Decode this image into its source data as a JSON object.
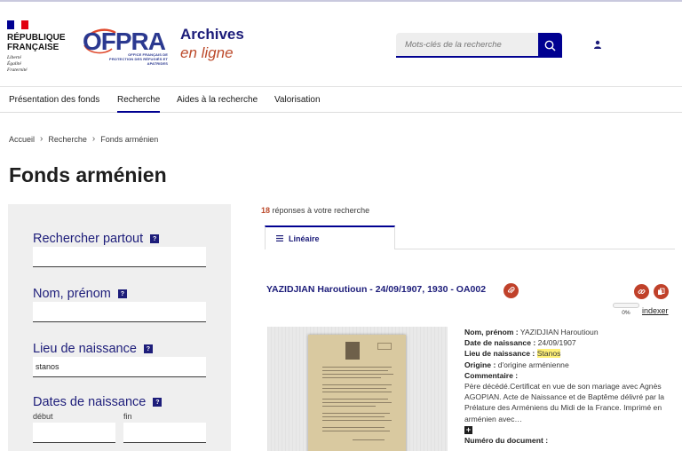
{
  "header": {
    "republique": [
      "RÉPUBLIQUE",
      "FRANÇAISE"
    ],
    "motto": [
      "Liberté",
      "Égalité",
      "Fraternité"
    ],
    "ofpra_name": "OFPRA",
    "ofpra_subtitle": "OFFICE FRANÇAIS DE PROTECTION DES RÉFUGIÉS ET APATRIDES",
    "site_title_line1": "Archives",
    "site_title_line2": "en ligne",
    "search_placeholder": "Mots-clés de la recherche"
  },
  "nav": {
    "items": [
      "Présentation des fonds",
      "Recherche",
      "Aides à la recherche",
      "Valorisation"
    ],
    "active": "Recherche"
  },
  "breadcrumb": [
    "Accueil",
    "Recherche",
    "Fonds arménien"
  ],
  "page_title": "Fonds arménien",
  "search_panel": {
    "fields": [
      {
        "label": "Rechercher partout",
        "value": ""
      },
      {
        "label": "Nom, prénom",
        "value": ""
      },
      {
        "label": "Lieu de naissance",
        "value": "stanos"
      },
      {
        "label": "Dates de naissance",
        "value": ""
      }
    ],
    "date_start_label": "début",
    "date_end_label": "fin",
    "help_symbol": "?"
  },
  "results": {
    "count": "18",
    "count_text": "réponses à votre recherche",
    "tab_label": "Linéaire",
    "item": {
      "title": "YAZIDJIAN Haroutioun - 24/09/1907, 1930 - OA002",
      "progress_text": "0%",
      "progress_value": 0,
      "indexer_label": "indexer",
      "fields": {
        "nom_label": "Nom, prénom :",
        "nom_value": "YAZIDJIAN Haroutioun",
        "date_label": "Date de naissance :",
        "date_value": "24/09/1907",
        "lieu_label": "Lieu de naissance :",
        "lieu_value": "Stanos",
        "origine_label": "Origine :",
        "origine_value": "d'origine arménienne",
        "commentaire_label": "Commentaire :",
        "commentaire_value": "Père décédé.Certificat en vue de son mariage avec Agnès AGOPIAN. Acte de Naissance et de Baptême délivré par la Prélature des Arméniens du Midi de la France. Imprimé en arménien avec…",
        "expand_symbol": "+",
        "numero_label": "Numéro du document :"
      }
    }
  },
  "colors": {
    "primary_blue": "#000091",
    "title_blue": "#1d1d7a",
    "accent_red": "#bc4a2b",
    "pill_red": "#c0412a",
    "panel_gray": "#efefef",
    "highlight_yellow": "#fff176"
  }
}
